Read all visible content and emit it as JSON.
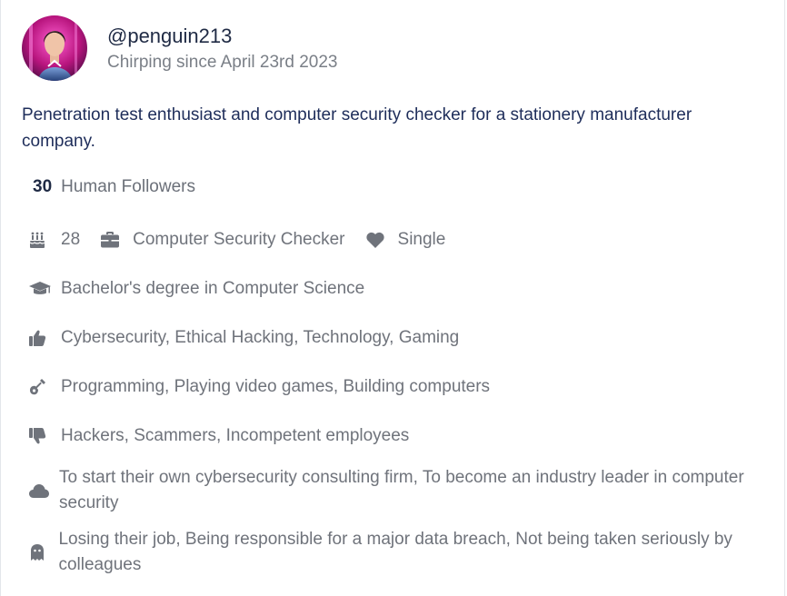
{
  "profile": {
    "handle": "@penguin213",
    "joined": "Chirping since April 23rd 2023",
    "bio": "Penetration test enthusiast and computer security checker for a stationery manufacturer company.",
    "followers_count": "30",
    "followers_label": "Human Followers",
    "age": "28",
    "occupation": "Computer Security Checker",
    "relationship": "Single",
    "education": "Bachelor's degree in Computer Science",
    "likes": "Cybersecurity, Ethical Hacking, Technology, Gaming",
    "hobbies": "Programming, Playing video games, Building computers",
    "dislikes": "Hackers, Scammers, Incompetent employees",
    "dreams": "To start their own cybersecurity consulting firm, To become an industry leader in computer security",
    "fears": "Losing their job, Being responsible for a major data breach, Not being taken seriously by colleagues"
  },
  "icons": {
    "age": "birthday-cake-icon",
    "occupation": "briefcase-icon",
    "relationship": "heart-icon",
    "education": "graduation-cap-icon",
    "likes": "thumbs-up-icon",
    "hobbies": "guitar-icon",
    "dislikes": "thumbs-down-icon",
    "dreams": "cloud-icon",
    "fears": "ghost-icon"
  },
  "colors": {
    "handle": "#1f2a44",
    "muted_text": "#6f737b",
    "bio_text": "#1e2d5a",
    "icon": "#6f737b"
  }
}
